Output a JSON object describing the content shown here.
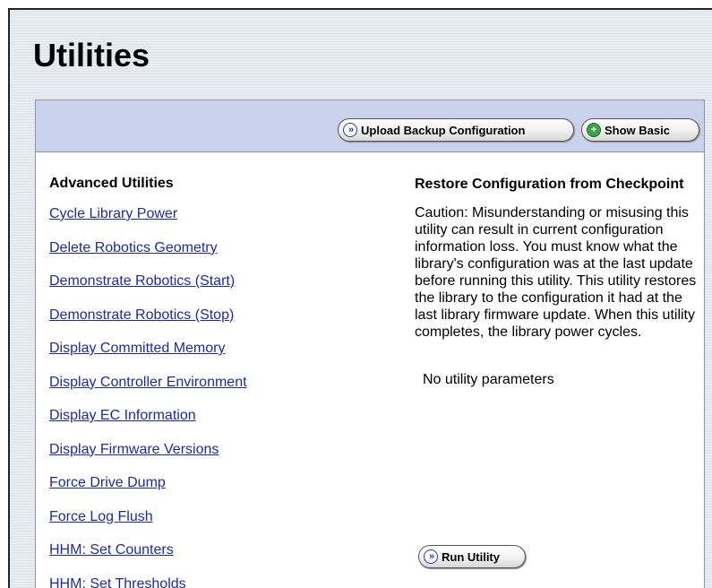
{
  "page": {
    "title": "Utilities"
  },
  "toolbar": {
    "upload_label": "Upload Backup Configuration",
    "show_basic_label": "Show Basic"
  },
  "left": {
    "heading": "Advanced Utilities",
    "links": [
      "Cycle Library Power",
      "Delete Robotics Geometry",
      "Demonstrate Robotics (Start)",
      "Demonstrate Robotics (Stop)",
      "Display Committed Memory",
      "Display Controller Environment",
      "Display EC Information",
      "Display Firmware Versions",
      "Force Drive Dump",
      "Force Log Flush",
      "HHM: Set Counters",
      "HHM: Set Thresholds"
    ]
  },
  "right": {
    "title": "Restore Configuration from Checkpoint",
    "caution": "Caution: Misunderstanding or misusing this utility can result in current configuration information loss. You must know what the library's configuration was at the last update before running this utility. This utility restores the library to the configuration it had at the last library firmware update. When this utility completes, the library power cycles.",
    "params": "No utility parameters",
    "run_label": "Run Utility"
  },
  "colors": {
    "toolbar_bg": "#c9d2ec",
    "link": "#1f2b9c",
    "go_icon": "#2b3d8c",
    "plus_icon": "#3aa347"
  },
  "icons": {
    "go": "double-chevron-right-icon",
    "plus": "plus-circle-icon"
  }
}
